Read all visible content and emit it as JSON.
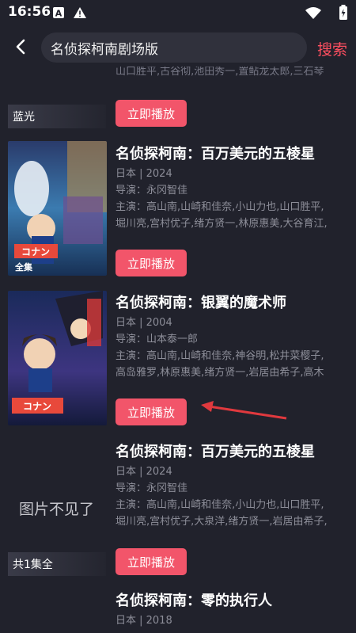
{
  "status_bar": {
    "time": "16:56"
  },
  "search": {
    "query": "名侦探柯南剧场版",
    "button": "搜索"
  },
  "prev_cast_tail": "山口胜平,古谷彻,池田秀一,置鲇龙太郎,三石琴",
  "items": [
    {
      "tag": "蓝光",
      "play": "立即播放"
    },
    {
      "title": "名侦探柯南：百万美元的五棱星",
      "meta": "日本 | 2024",
      "director": "导演：永冈智佳",
      "cast_l1": "主演：高山南,山崎和佳奈,小山力也,山口胜平,",
      "cast_l2": "堀川亮,宫村优子,绪方贤一,林原惠美,大谷育江,",
      "poster_text": "全集",
      "play": "立即播放"
    },
    {
      "title": "名侦探柯南：银翼的魔术师",
      "meta": "日本 | 2004",
      "director": "导演：山本泰一郎",
      "cast_l1": "主演：高山南,山崎和佳奈,神谷明,松井菜樱子,",
      "cast_l2": "高岛雅罗,林原惠美,绪方贤一,岩居由希子,高木",
      "play": "立即播放"
    },
    {
      "title": "名侦探柯南：百万美元的五棱星",
      "meta": "日本 | 2024",
      "director": "导演：永冈智佳",
      "cast_l1": "主演：高山南,山崎和佳奈,小山力也,山口胜平,",
      "cast_l2": "堀川亮,宫村优子,大泉洋,绪方贤一,岩居由希子,",
      "missing_poster": "图片不见了",
      "tag": "共1集全",
      "play": "立即播放"
    },
    {
      "title": "名侦探柯南：零的执行人",
      "meta": "日本 | 2018"
    }
  ],
  "colors": {
    "accent": "#f2556a",
    "background": "#21222c",
    "search_text": "#ff4f60"
  },
  "icons": [
    "letter-a-icon",
    "warning-icon",
    "wifi-icon",
    "battery-icon",
    "back-arrow-icon"
  ]
}
